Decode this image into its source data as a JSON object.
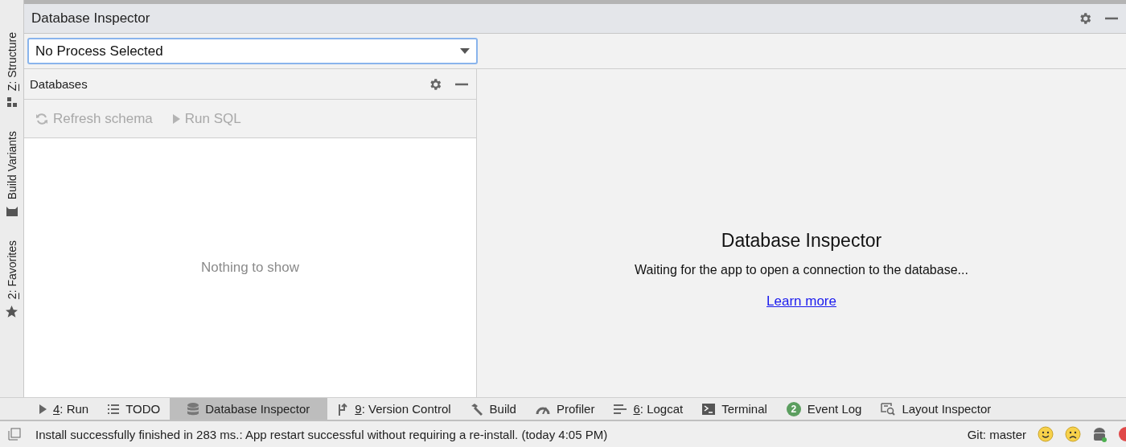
{
  "side_tabs": [
    {
      "label": "Z: Structure",
      "mnemonic": true
    },
    {
      "label": "Build Variants",
      "mnemonic": false
    },
    {
      "label": "2: Favorites",
      "mnemonic": true
    }
  ],
  "tool_window": {
    "title": "Database Inspector"
  },
  "process_selector": {
    "value": "No Process Selected"
  },
  "databases_panel": {
    "title": "Databases",
    "toolbar": [
      {
        "label": "Refresh schema",
        "disabled": true
      },
      {
        "label": "Run SQL",
        "disabled": true
      }
    ],
    "empty_text": "Nothing to show"
  },
  "main_panel": {
    "heading": "Database Inspector",
    "message": "Waiting for the app to open a connection to the database...",
    "link": "Learn more"
  },
  "bottom_tabs": [
    {
      "label": "4: Run",
      "mnemonic": true,
      "selected": false
    },
    {
      "label": "TODO",
      "mnemonic": false,
      "selected": false
    },
    {
      "label": "Database Inspector",
      "mnemonic": false,
      "selected": true
    },
    {
      "label": "9: Version Control",
      "mnemonic": true,
      "selected": false
    },
    {
      "label": "Build",
      "mnemonic": false,
      "selected": false
    },
    {
      "label": "Profiler",
      "mnemonic": false,
      "selected": false
    },
    {
      "label": "6: Logcat",
      "mnemonic": true,
      "selected": false
    },
    {
      "label": "Terminal",
      "mnemonic": false,
      "selected": false
    },
    {
      "label": "Event Log",
      "mnemonic": false,
      "badge": "2",
      "selected": false
    },
    {
      "label": "Layout Inspector",
      "mnemonic": false,
      "selected": false
    }
  ],
  "status_bar": {
    "message": "Install successfully finished in 283 ms.: App restart successful without requiring a re-install. (today 4:05 PM)",
    "branch": "Git: master"
  }
}
